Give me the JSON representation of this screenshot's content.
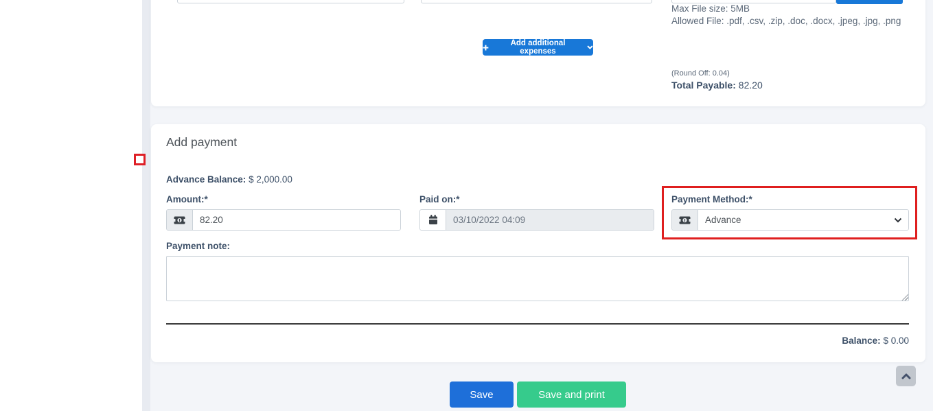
{
  "colors": {
    "button_blue": "#1878d8",
    "save_blue": "#1e6fd9",
    "success_green": "#36cb8c",
    "highlight_red": "#df1f1f",
    "label_navy": "#3d5068"
  },
  "expenses_section": {
    "upload_hint_line1": "Max File size: 5MB",
    "upload_hint_line2": "Allowed File: .pdf, .csv, .zip, .doc, .docx, .jpeg, .jpg, .png",
    "add_expenses_button_label": "Add additional expenses",
    "round_off_text": "(Round Off: 0.04)",
    "total_payable_label": "Total Payable:",
    "total_payable_value": "82.20"
  },
  "payment_section": {
    "title": "Add payment",
    "advance_balance_label": "Advance Balance:",
    "advance_balance_value": "$ 2,000.00",
    "amount_label": "Amount:*",
    "amount_value": "82.20",
    "paid_on_label": "Paid on:*",
    "paid_on_value": "03/10/2022 04:09",
    "payment_method_label": "Payment Method:*",
    "payment_method_selected": "Advance",
    "payment_note_label": "Payment note:",
    "payment_note_value": "",
    "balance_label": "Balance:",
    "balance_value": "$ 0.00"
  },
  "footer_actions": {
    "save_label": "Save",
    "save_and_print_label": "Save and print"
  }
}
